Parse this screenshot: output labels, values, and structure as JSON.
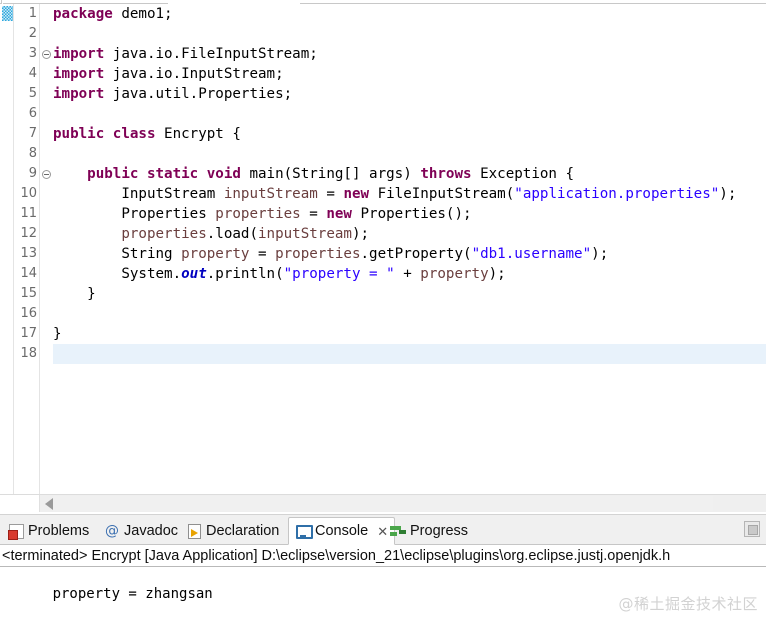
{
  "editor": {
    "first_line": 1,
    "last_line": 18,
    "current_line": 18,
    "line_numbers": [
      "1",
      "2",
      "3",
      "4",
      "5",
      "6",
      "7",
      "8",
      "9",
      "10",
      "11",
      "12",
      "13",
      "14",
      "15",
      "16",
      "17",
      "18"
    ],
    "fold_lines": [
      "3",
      "9"
    ],
    "lines": [
      {
        "n": "1",
        "tokens": [
          {
            "t": "package",
            "c": "kw"
          },
          {
            "t": " demo1;",
            "c": "plain"
          }
        ]
      },
      {
        "n": "2",
        "tokens": []
      },
      {
        "n": "3",
        "tokens": [
          {
            "t": "import",
            "c": "kw"
          },
          {
            "t": " java.io.FileInputStream;",
            "c": "plain"
          }
        ]
      },
      {
        "n": "4",
        "tokens": [
          {
            "t": "import",
            "c": "kw"
          },
          {
            "t": " java.io.InputStream;",
            "c": "plain"
          }
        ]
      },
      {
        "n": "5",
        "tokens": [
          {
            "t": "import",
            "c": "kw"
          },
          {
            "t": " java.util.Properties;",
            "c": "plain"
          }
        ]
      },
      {
        "n": "6",
        "tokens": []
      },
      {
        "n": "7",
        "tokens": [
          {
            "t": "public",
            "c": "kw"
          },
          {
            "t": " ",
            "c": "plain"
          },
          {
            "t": "class",
            "c": "kw"
          },
          {
            "t": " Encrypt {",
            "c": "plain"
          }
        ]
      },
      {
        "n": "8",
        "tokens": []
      },
      {
        "n": "9",
        "tokens": [
          {
            "t": "    ",
            "c": "plain"
          },
          {
            "t": "public",
            "c": "kw"
          },
          {
            "t": " ",
            "c": "plain"
          },
          {
            "t": "static",
            "c": "kw"
          },
          {
            "t": " ",
            "c": "plain"
          },
          {
            "t": "void",
            "c": "kw"
          },
          {
            "t": " main(String[] args) ",
            "c": "plain"
          },
          {
            "t": "throws",
            "c": "kw"
          },
          {
            "t": " Exception {",
            "c": "plain"
          }
        ]
      },
      {
        "n": "10",
        "tokens": [
          {
            "t": "        InputStream ",
            "c": "plain"
          },
          {
            "t": "inputStream",
            "c": "var"
          },
          {
            "t": " = ",
            "c": "plain"
          },
          {
            "t": "new",
            "c": "kw"
          },
          {
            "t": " FileInputStream(",
            "c": "plain"
          },
          {
            "t": "\"application.properties\"",
            "c": "str"
          },
          {
            "t": ");",
            "c": "plain"
          }
        ]
      },
      {
        "n": "11",
        "tokens": [
          {
            "t": "        Properties ",
            "c": "plain"
          },
          {
            "t": "properties",
            "c": "var"
          },
          {
            "t": " = ",
            "c": "plain"
          },
          {
            "t": "new",
            "c": "kw"
          },
          {
            "t": " Properties();",
            "c": "plain"
          }
        ]
      },
      {
        "n": "12",
        "tokens": [
          {
            "t": "        ",
            "c": "plain"
          },
          {
            "t": "properties",
            "c": "var"
          },
          {
            "t": ".load(",
            "c": "plain"
          },
          {
            "t": "inputStream",
            "c": "var"
          },
          {
            "t": ");",
            "c": "plain"
          }
        ]
      },
      {
        "n": "13",
        "tokens": [
          {
            "t": "        String ",
            "c": "plain"
          },
          {
            "t": "property",
            "c": "var"
          },
          {
            "t": " = ",
            "c": "plain"
          },
          {
            "t": "properties",
            "c": "var"
          },
          {
            "t": ".getProperty(",
            "c": "plain"
          },
          {
            "t": "\"db1.username\"",
            "c": "str"
          },
          {
            "t": ");",
            "c": "plain"
          }
        ]
      },
      {
        "n": "14",
        "tokens": [
          {
            "t": "        System.",
            "c": "plain"
          },
          {
            "t": "out",
            "c": "stat"
          },
          {
            "t": ".println(",
            "c": "plain"
          },
          {
            "t": "\"property = \"",
            "c": "str"
          },
          {
            "t": " + ",
            "c": "plain"
          },
          {
            "t": "property",
            "c": "var"
          },
          {
            "t": ");",
            "c": "plain"
          }
        ]
      },
      {
        "n": "15",
        "tokens": [
          {
            "t": "    }",
            "c": "plain"
          }
        ]
      },
      {
        "n": "16",
        "tokens": []
      },
      {
        "n": "17",
        "tokens": [
          {
            "t": "}",
            "c": "plain"
          }
        ]
      },
      {
        "n": "18",
        "tokens": []
      }
    ],
    "colors": {
      "keyword": "#7f0055",
      "string": "#2a00ff",
      "local_variable": "#6a3e3e",
      "static_field": "#0000c0",
      "current_line_highlight": "#e8f2fb",
      "background": "#ffffff"
    }
  },
  "bottom_panel": {
    "tabs": [
      {
        "label": "Problems",
        "icon": "problems-icon",
        "active": false,
        "closable": false
      },
      {
        "label": "Javadoc",
        "icon": "javadoc-at-icon",
        "active": false,
        "closable": false
      },
      {
        "label": "Declaration",
        "icon": "declaration-icon",
        "active": false,
        "closable": false
      },
      {
        "label": "Console",
        "icon": "console-icon",
        "active": true,
        "closable": true
      },
      {
        "label": "Progress",
        "icon": "progress-icon",
        "active": false,
        "closable": false
      }
    ],
    "close_glyph": "✕",
    "maximize_button": "maximize-icon",
    "console": {
      "header": "<terminated> Encrypt [Java Application] D:\\eclipse\\version_21\\eclipse\\plugins\\org.eclipse.justj.openjdk.h",
      "output": "property = zhangsan"
    }
  },
  "watermark": "@稀土掘金技术社区"
}
